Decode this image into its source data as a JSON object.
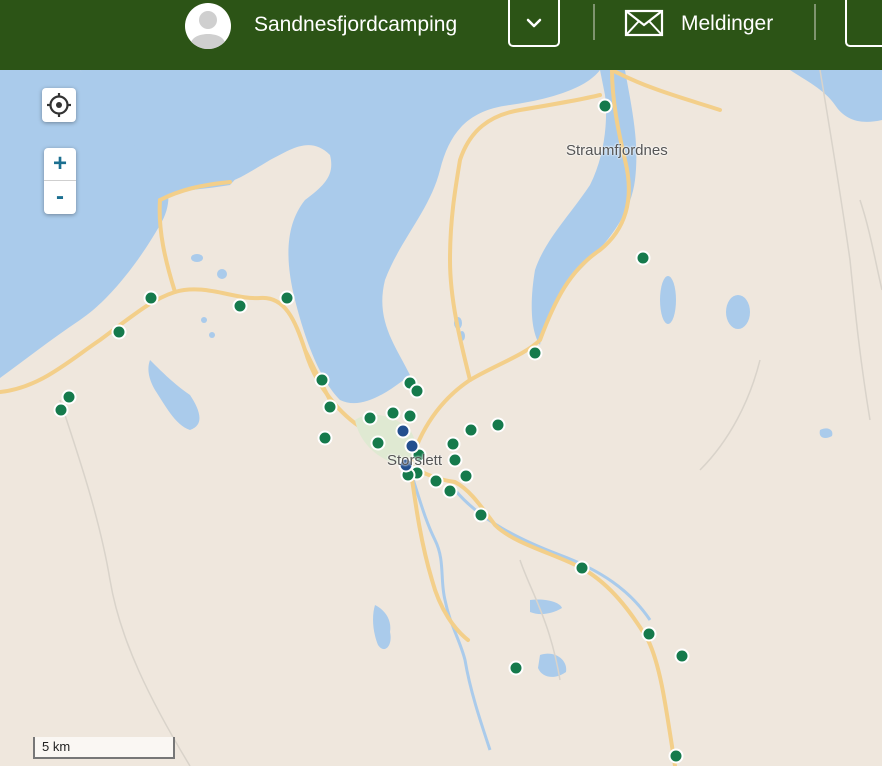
{
  "header": {
    "username": "Sandnesfjordcamping",
    "messages_label": "Meldinger",
    "icons": {
      "avatar": "user-avatar-icon",
      "dropdown": "chevron-down-icon",
      "messages": "envelope-icon"
    },
    "colors": {
      "bar": "#2c5416",
      "text": "#ffffff"
    }
  },
  "map": {
    "controls": {
      "locate_icon": "crosshair-icon",
      "zoom_in": "+",
      "zoom_out": "-"
    },
    "labels": {
      "straumfjordnes": "Straumfjordnes",
      "storslett": "Storslett"
    },
    "scale": "5 km",
    "colors": {
      "land": "#efe7dd",
      "water": "#aacbeb",
      "road": "#f7d58f",
      "marker_green": "#157a4c",
      "marker_blue": "#234f8e"
    },
    "marker_counts": {
      "green": 43,
      "blue": 3
    }
  }
}
